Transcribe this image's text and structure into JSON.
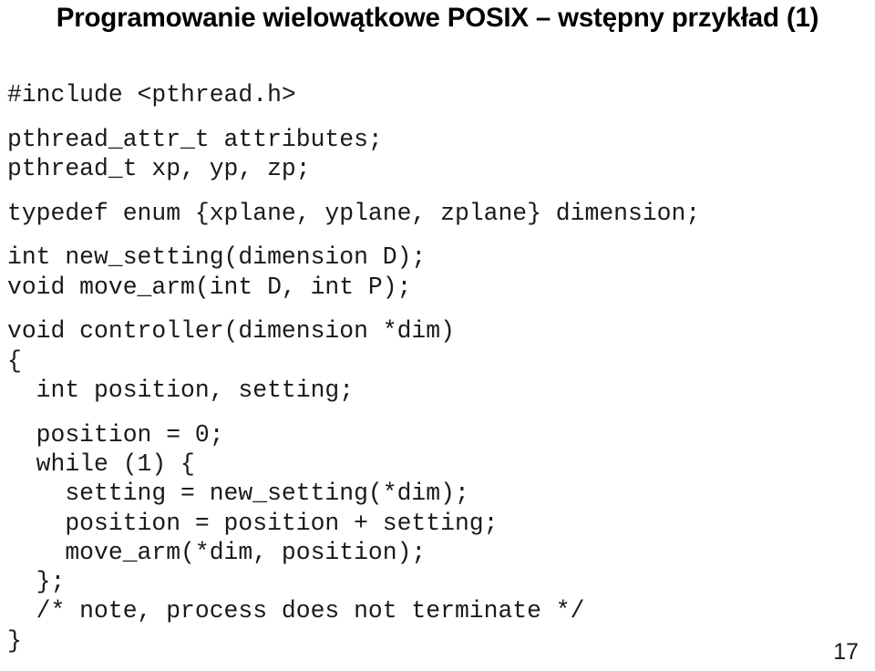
{
  "slide": {
    "title": "Programowanie wielowątkowe POSIX – wstępny przykład (1)",
    "page_number": "17",
    "background_color": "#ffffff",
    "text_color": "#000000",
    "code_color": "#1a1a1a"
  },
  "code": {
    "language": "c",
    "lines": [
      {
        "text": "#include <pthread.h>",
        "blank": false
      },
      {
        "text": "",
        "blank": true
      },
      {
        "text": "pthread_attr_t attributes;",
        "blank": false
      },
      {
        "text": "pthread_t xp, yp, zp;",
        "blank": false
      },
      {
        "text": "",
        "blank": true
      },
      {
        "text": "typedef enum {xplane, yplane, zplane} dimension;",
        "blank": false
      },
      {
        "text": "",
        "blank": true
      },
      {
        "text": "int new_setting(dimension D);",
        "blank": false
      },
      {
        "text": "void move_arm(int D, int P);",
        "blank": false
      },
      {
        "text": "",
        "blank": true
      },
      {
        "text": "void controller(dimension *dim)",
        "blank": false
      },
      {
        "text": "{",
        "blank": false
      },
      {
        "text": "  int position, setting;",
        "blank": false
      },
      {
        "text": "",
        "blank": true
      },
      {
        "text": "  position = 0;",
        "blank": false
      },
      {
        "text": "  while (1) {",
        "blank": false
      },
      {
        "text": "    setting = new_setting(*dim);",
        "blank": false
      },
      {
        "text": "    position = position + setting;",
        "blank": false
      },
      {
        "text": "    move_arm(*dim, position);",
        "blank": false
      },
      {
        "text": "  };",
        "blank": false
      },
      {
        "text": "  /* note, process does not terminate */",
        "blank": false
      },
      {
        "text": "}",
        "blank": false
      }
    ]
  }
}
